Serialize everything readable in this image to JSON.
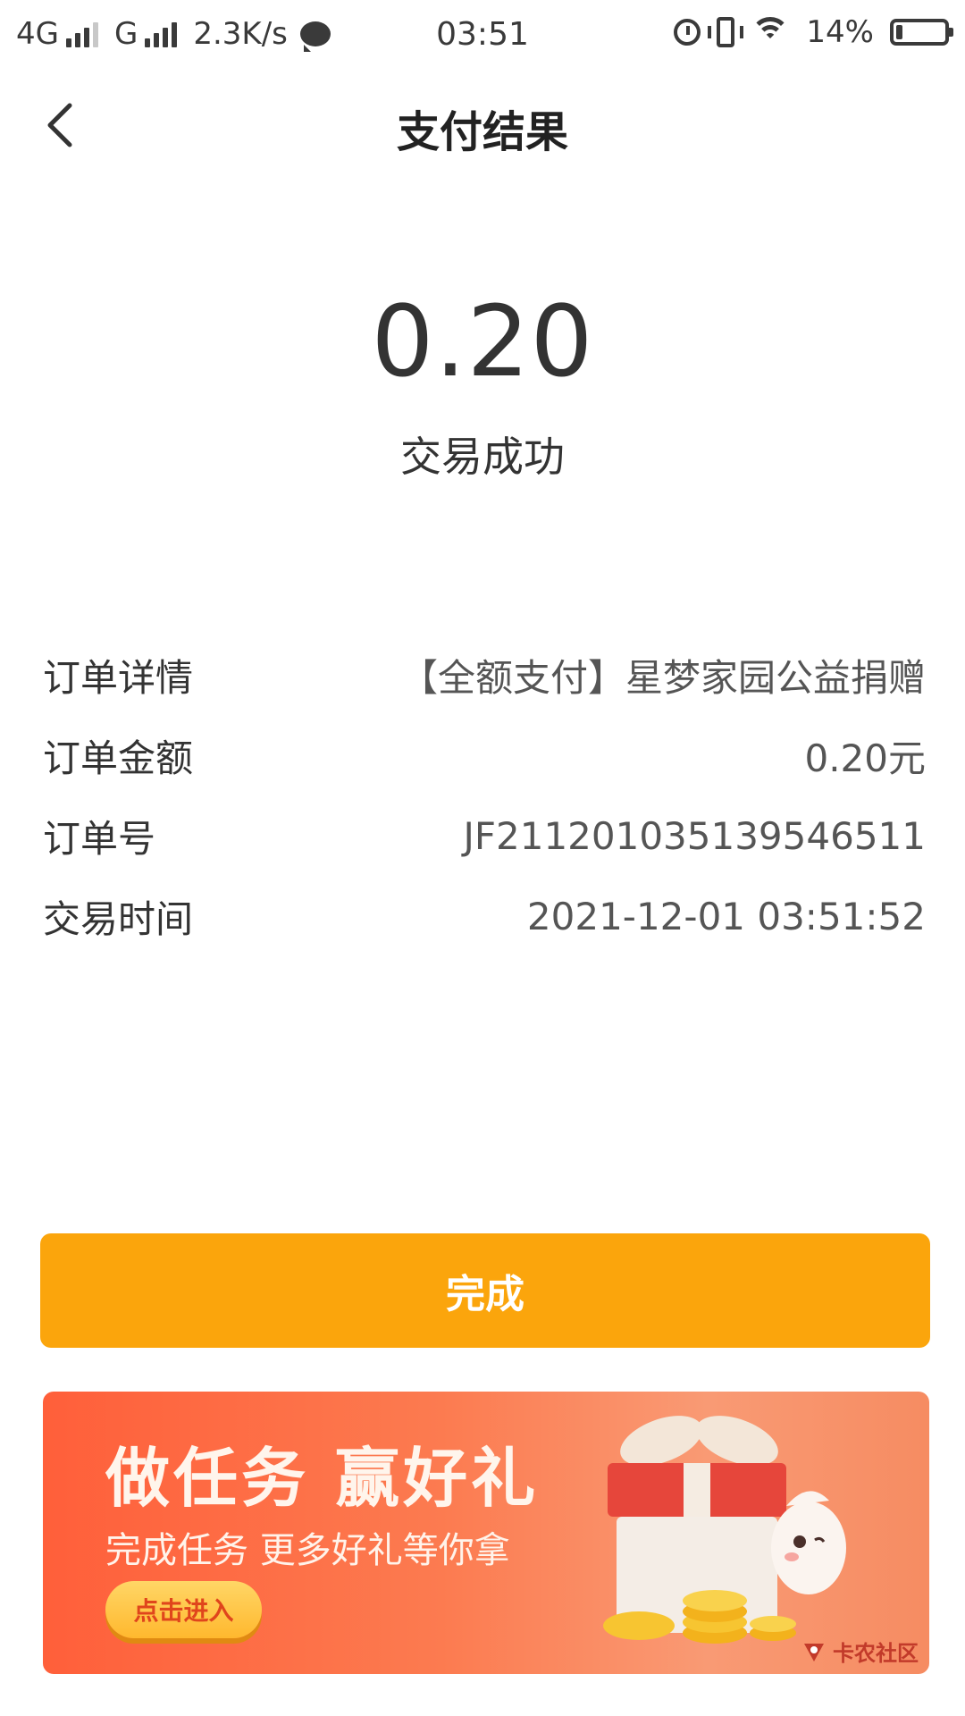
{
  "status_bar": {
    "network_1": "4G",
    "network_2": "G",
    "speed": "2.3K/s",
    "time": "03:51",
    "battery": "14%",
    "battery_level": 0.14
  },
  "header": {
    "title": "支付结果"
  },
  "result": {
    "amount": "0.20",
    "status": "交易成功"
  },
  "details": [
    {
      "label": "订单详情",
      "value": "【全额支付】星梦家园公益捐赠"
    },
    {
      "label": "订单金额",
      "value": "0.20元"
    },
    {
      "label": "订单号",
      "value": "JF2112010351395465​11"
    },
    {
      "label": "交易时间",
      "value": "2021-12-01 03:51:52"
    }
  ],
  "actions": {
    "done_label": "完成"
  },
  "banner": {
    "title": "做任务 赢好礼",
    "subtitle": "完成任务 更多好礼等你拿",
    "cta": "点击进入"
  },
  "watermark": {
    "text": "卡农社区"
  },
  "colors": {
    "primary_button": "#fba50c",
    "banner_start": "#ff5f3a",
    "banner_end": "#f68c62"
  }
}
